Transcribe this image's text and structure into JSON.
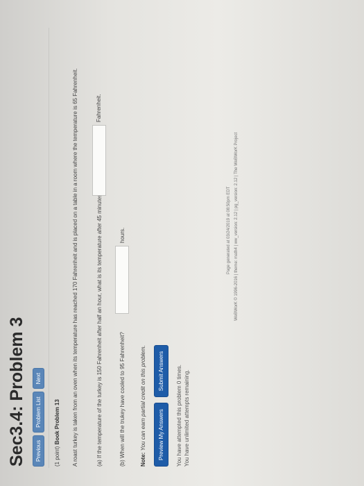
{
  "header": {
    "title": "Sec3.4: Problem 3"
  },
  "nav": {
    "previous": "Previous",
    "problem_list": "Problem List",
    "next": "Next"
  },
  "problem": {
    "points_label": "(1 point)",
    "book_label": "Book Problem 13",
    "statement": "A roast turkey is taken from an oven when its temperature has reached 170 Fahrenheit and is placed on a table in a room where the temperature is 65 Fahrenheit.",
    "part_a": "(a) If the temperature of the turkey is 150 Fahrenheit after half an hour, what is its temperature after 45 minutes?",
    "part_a_value": "",
    "part_a_unit": "Fahrenheit.",
    "part_b": "(b) When will the trukey have cooled to 95 Fahrenheit?",
    "part_b_value": "",
    "part_b_unit": "hours."
  },
  "note": {
    "label": "Note:",
    "text": "You can earn partial credit on this problem."
  },
  "actions": {
    "preview": "Preview My Answers",
    "submit": "Submit Answers"
  },
  "status": {
    "attempted": "You have attempted this problem 0 times.",
    "remaining": "You have unlimited attempts remaining."
  },
  "footer": {
    "generated": "Page generated at 03/24/2019 at 08:50pm EDT",
    "copyright": "WeBWorK © 1996-2016 | theme: math4 | ww_version: 2.12 | pg_version: 2.12 | The WeBWorK Project"
  },
  "colors": {
    "nav_button": "#5a86b8",
    "action_button": "#1e5ca8"
  }
}
